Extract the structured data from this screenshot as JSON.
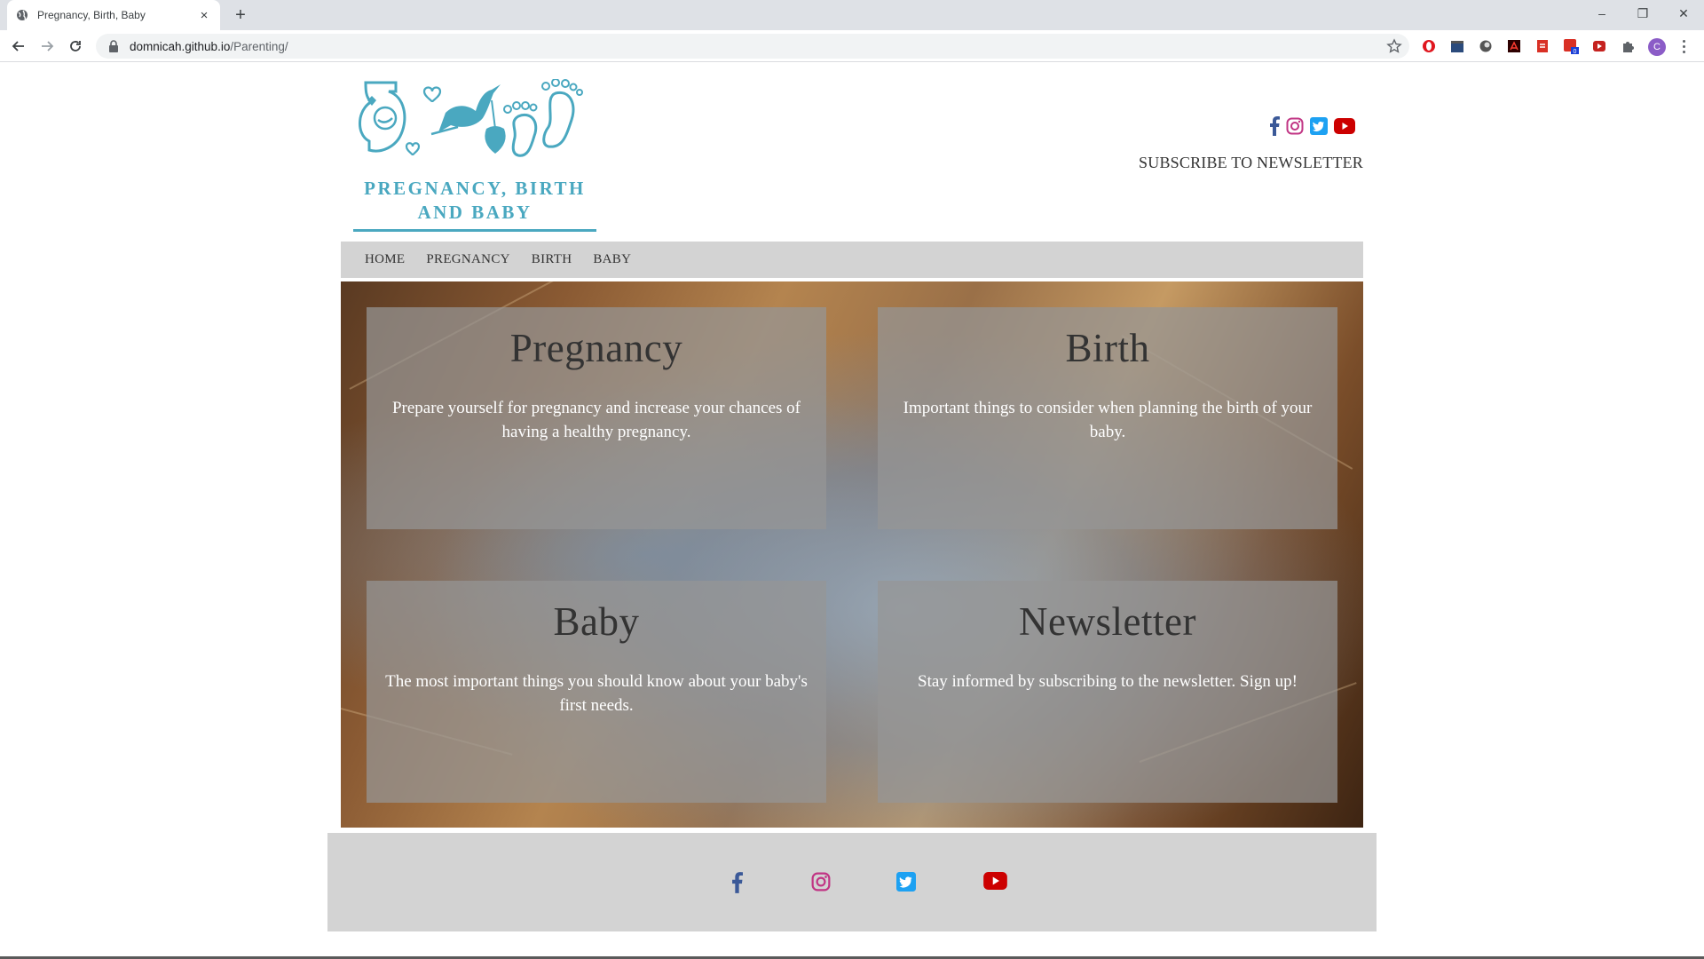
{
  "browser": {
    "tab_title": "Pregnancy, Birth, Baby",
    "new_tab": "+",
    "url_host": "domnicah.github.io",
    "url_path": "/Parenting/",
    "profile_initial": "C",
    "window_controls": {
      "minimize": "–",
      "restore": "❐",
      "close": "✕"
    },
    "tab_close": "×"
  },
  "header": {
    "logo_text_line1": "PREGNANCY, BIRTH",
    "logo_text_line2": "AND BABY",
    "subscribe": "SUBSCRIBE TO NEWSLETTER",
    "social": [
      "facebook-icon",
      "instagram-icon",
      "twitter-icon",
      "youtube-icon"
    ]
  },
  "nav": {
    "items": [
      {
        "label": "HOME"
      },
      {
        "label": "PREGNANCY"
      },
      {
        "label": "BIRTH"
      },
      {
        "label": "BABY"
      }
    ]
  },
  "cards": [
    {
      "title": "Pregnancy",
      "text": "Prepare yourself for pregnancy and increase your chances of having a healthy pregnancy."
    },
    {
      "title": "Birth",
      "text": "Important things to consider when planning the birth of your baby."
    },
    {
      "title": "Baby",
      "text": "The most important things you should know about your baby's first needs."
    },
    {
      "title": "Newsletter",
      "text": "Stay informed by subscribing to the newsletter. Sign up!"
    }
  ],
  "colors": {
    "brand": "#4aa8c0",
    "nav_bg": "#d3d3d3",
    "facebook": "#3b5998",
    "instagram": "#c13584",
    "twitter": "#1da1f2",
    "youtube": "#cc0000"
  }
}
